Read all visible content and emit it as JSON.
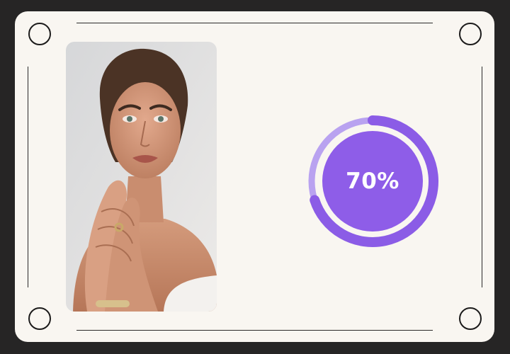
{
  "progress": {
    "fraction": 0.7,
    "label": "70%"
  },
  "photo": {
    "subject": "portrait-woman-with-hands-near-face"
  },
  "colors": {
    "background": "#262525",
    "card": "#f9f6f1",
    "gauge_fill": "#8b5ce6",
    "gauge_track": "#b9a2f0",
    "gauge_center": "#8e5de8",
    "label_text": "#ffffff"
  },
  "icons": {
    "corners": [
      "circle-outline-icon",
      "circle-outline-icon",
      "circle-outline-icon",
      "circle-outline-icon"
    ]
  }
}
